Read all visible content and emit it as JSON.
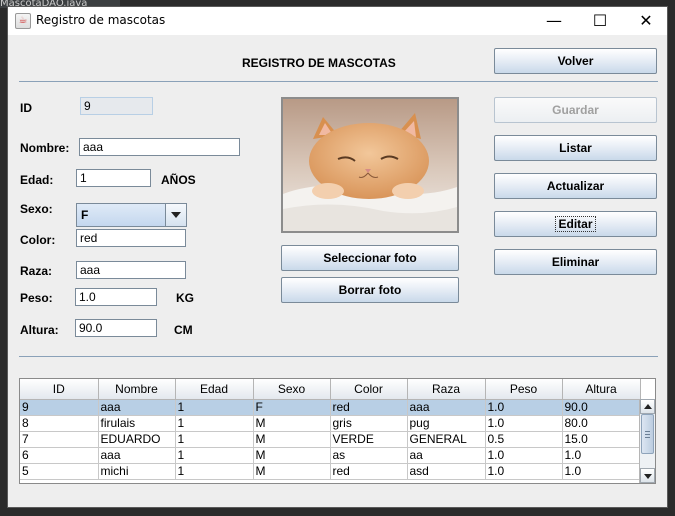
{
  "background": {
    "tab_text": "MascotaDAO.java"
  },
  "window": {
    "title": "Registro de mascotas",
    "controls": {
      "minimize": "—",
      "maximize": "☐",
      "close": "✕"
    }
  },
  "header": {
    "title": "REGISTRO DE MASCOTAS"
  },
  "form": {
    "id_label": "ID",
    "id_value": "9",
    "nombre_label": "Nombre:",
    "nombre_value": "aaa",
    "edad_label": "Edad:",
    "edad_value": "1",
    "edad_unit": "AÑOS",
    "sexo_label": "Sexo:",
    "sexo_value": "F",
    "color_label": "Color:",
    "color_value": "red",
    "raza_label": "Raza:",
    "raza_value": "aaa",
    "peso_label": "Peso:",
    "peso_value": "1.0",
    "peso_unit": "KG",
    "altura_label": "Altura:",
    "altura_value": "90.0",
    "altura_unit": "CM"
  },
  "photo": {
    "select_label": "Seleccionar foto",
    "delete_label": "Borrar foto"
  },
  "actions": {
    "volver": "Volver",
    "guardar": "Guardar",
    "listar": "Listar",
    "actualizar": "Actualizar",
    "editar": "Editar",
    "eliminar": "Eliminar"
  },
  "table": {
    "columns": [
      "ID",
      "Nombre",
      "Edad",
      "Sexo",
      "Color",
      "Raza",
      "Peso",
      "Altura"
    ],
    "rows": [
      [
        "9",
        "aaa",
        "1",
        "F",
        "red",
        "aaa",
        "1.0",
        "90.0"
      ],
      [
        "8",
        "firulais",
        "1",
        "M",
        "gris",
        "pug",
        "1.0",
        "80.0"
      ],
      [
        "7",
        "EDUARDO",
        "1",
        "M",
        "VERDE",
        "GENERAL",
        "0.5",
        "15.0"
      ],
      [
        "6",
        "aaa",
        "1",
        "M",
        "as",
        "aa",
        "1.0",
        "1.0"
      ],
      [
        "5",
        "michi",
        "1",
        "M",
        "red",
        "asd",
        "1.0",
        "1.0"
      ]
    ],
    "selected_row": 0
  },
  "colors": {
    "selection": "#b8cfe5",
    "separator": "#8aa1b8",
    "window_bg": "#eeeeee"
  }
}
